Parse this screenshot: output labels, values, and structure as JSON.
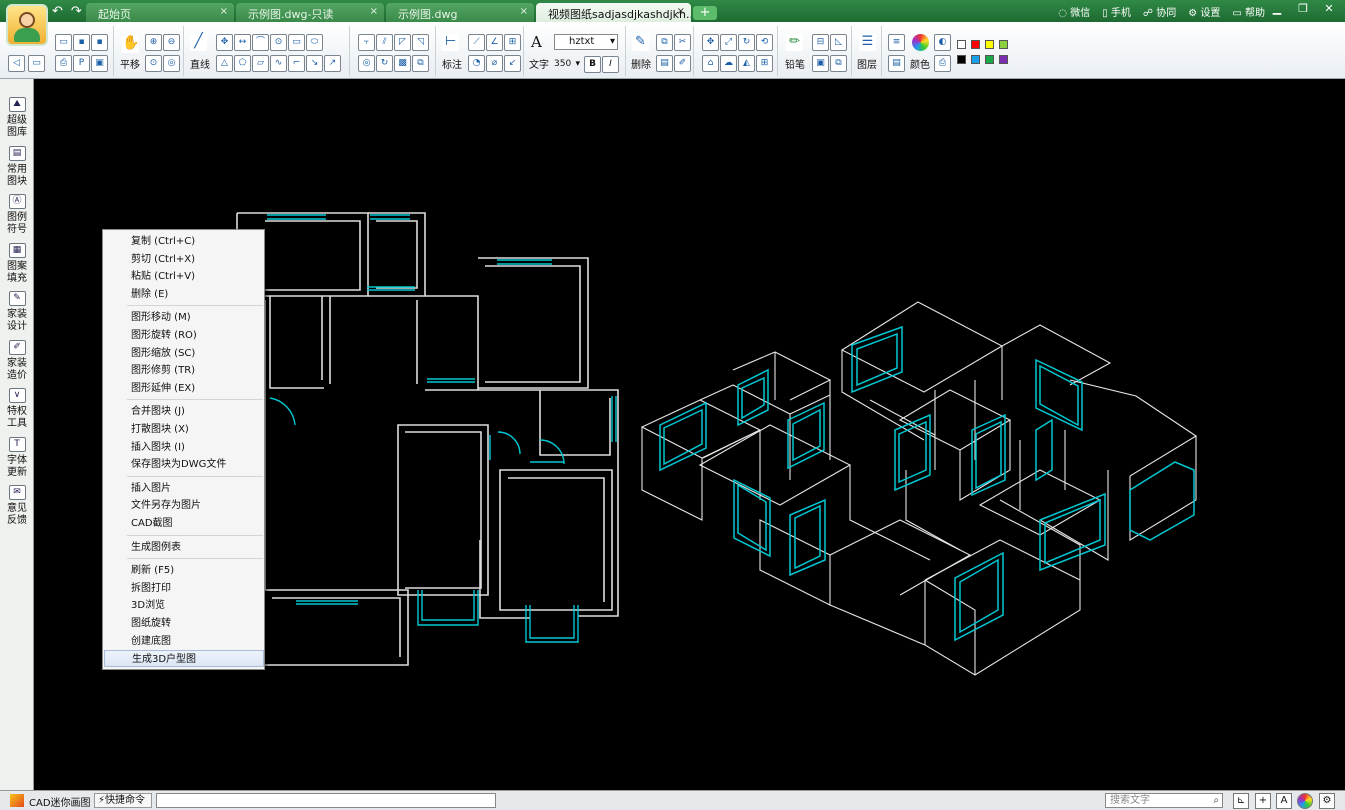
{
  "app": {
    "name": "CAD迷你画图"
  },
  "quick_access": {
    "undo": "↶",
    "redo": "↷"
  },
  "tabs": [
    {
      "label": "起始页",
      "close": "×",
      "active": false
    },
    {
      "label": "示例图.dwg-只读",
      "close": "×",
      "active": false
    },
    {
      "label": "示例图.dwg",
      "close": "×",
      "active": false
    },
    {
      "label": "视频图纸sadjasdjkashdjkh...",
      "close": "×",
      "active": true
    }
  ],
  "tab_add": "+",
  "top_links": [
    "微信",
    "手机",
    "协同",
    "设置",
    "帮助"
  ],
  "window_controls": {
    "minimize": "▁",
    "restore": "❐",
    "close": "✕"
  },
  "ribbon": {
    "pan_label": "平移",
    "line_label": "直线",
    "dim_label": "标注",
    "text_label": "文字",
    "font_value": "hztxt",
    "size_value": "350",
    "bold": "B",
    "italic": "I",
    "delete_label": "删除",
    "pencil_label": "铅笔",
    "layer_label": "图层",
    "color_label": "颜色",
    "text_icon": "A",
    "swatches": [
      "#ffffff",
      "#ff0000",
      "#ffff00",
      "#8bd13f",
      "#000000",
      "#1aa0e8",
      "#1aa84a",
      "#7b2fb0"
    ]
  },
  "sidebar": [
    {
      "name": "super-library",
      "line1": "超级",
      "line2": "图库"
    },
    {
      "name": "common-blocks",
      "line1": "常用",
      "line2": "图块"
    },
    {
      "name": "legend-symbols",
      "line1": "图例",
      "line2": "符号"
    },
    {
      "name": "pattern-fill",
      "line1": "图案",
      "line2": "填充"
    },
    {
      "name": "home-design",
      "line1": "家装",
      "line2": "设计"
    },
    {
      "name": "home-cost",
      "line1": "家装",
      "line2": "造价"
    },
    {
      "name": "special-tools",
      "line1": "特权",
      "line2": "工具"
    },
    {
      "name": "font-update",
      "line1": "字体",
      "line2": "更新"
    },
    {
      "name": "feedback",
      "line1": "意见",
      "line2": "反馈"
    }
  ],
  "context_menu": [
    [
      "复制 (Ctrl+C)",
      "剪切 (Ctrl+X)",
      "粘贴 (Ctrl+V)",
      "删除 (E)"
    ],
    [
      "图形移动 (M)",
      "图形旋转 (RO)",
      "图形缩放 (SC)",
      "图形修剪 (TR)",
      "图形延伸 (EX)"
    ],
    [
      "合并图块 (J)",
      "打散图块 (X)",
      "插入图块 (I)",
      "保存图块为DWG文件"
    ],
    [
      "插入图片",
      "文件另存为图片",
      "CAD截图"
    ],
    [
      "生成图例表"
    ],
    [
      "刷新 (F5)",
      "拆图打印",
      "3D浏览",
      "图纸旋转",
      "创建底图",
      "生成3D户型图"
    ]
  ],
  "context_menu_highlighted": "生成3D户型图",
  "status": {
    "app_name": "CAD迷你画图",
    "quick_command": "快捷命令",
    "command_value": "",
    "search_placeholder": "搜索文字"
  }
}
